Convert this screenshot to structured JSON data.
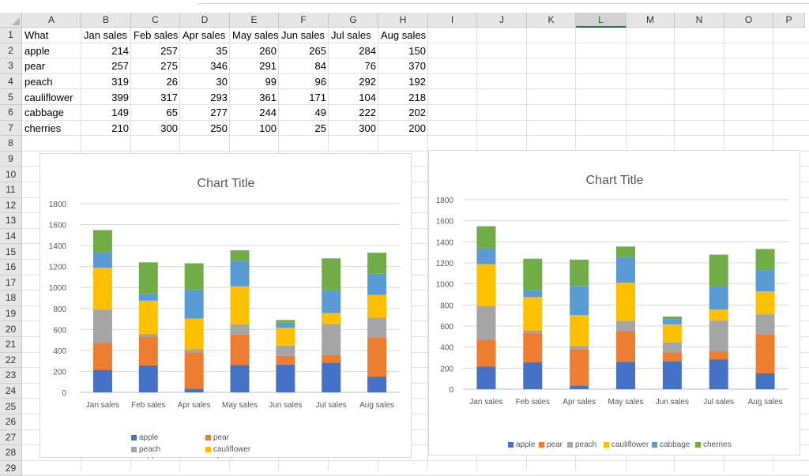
{
  "sheet": {
    "columns": [
      "A",
      "B",
      "C",
      "D",
      "E",
      "F",
      "G",
      "H",
      "I",
      "J",
      "K",
      "L",
      "M",
      "N",
      "O",
      "P"
    ],
    "selected_column": "L",
    "rows": [
      "1",
      "2",
      "3",
      "4",
      "5",
      "6",
      "7",
      "8",
      "9",
      "10",
      "11",
      "12",
      "13",
      "14",
      "15",
      "16",
      "17",
      "18",
      "19",
      "20",
      "21",
      "22",
      "23",
      "24",
      "25",
      "26",
      "27",
      "28",
      "29"
    ],
    "table": {
      "header": [
        "What",
        "Jan sales",
        "Feb sales",
        "Apr sales",
        "May sales",
        "Jun sales",
        "Jul sales",
        "Aug sales"
      ],
      "data": [
        [
          "apple",
          "214",
          "257",
          "35",
          "260",
          "265",
          "284",
          "150"
        ],
        [
          "pear",
          "257",
          "275",
          "346",
          "291",
          "84",
          "76",
          "370"
        ],
        [
          "peach",
          "319",
          "26",
          "30",
          "99",
          "96",
          "292",
          "192"
        ],
        [
          "cauliflower",
          "399",
          "317",
          "293",
          "361",
          "171",
          "104",
          "218"
        ],
        [
          "cabbage",
          "149",
          "65",
          "277",
          "244",
          "49",
          "222",
          "202"
        ],
        [
          "cherries",
          "210",
          "300",
          "250",
          "100",
          "25",
          "300",
          "200"
        ]
      ]
    }
  },
  "chart_data": [
    {
      "type": "bar",
      "stacked": true,
      "title": "Chart Title",
      "categories": [
        "Jan sales",
        "Feb sales",
        "Apr sales",
        "May sales",
        "Jun sales",
        "Jul sales",
        "Aug sales"
      ],
      "series": [
        {
          "name": "apple",
          "color": "#4472C4",
          "values": [
            214,
            257,
            35,
            260,
            265,
            284,
            150
          ]
        },
        {
          "name": "pear",
          "color": "#ED7D31",
          "values": [
            257,
            275,
            346,
            291,
            84,
            76,
            370
          ]
        },
        {
          "name": "peach",
          "color": "#A5A5A5",
          "values": [
            319,
            26,
            30,
            99,
            96,
            292,
            192
          ]
        },
        {
          "name": "cauliflower",
          "color": "#FFC000",
          "values": [
            399,
            317,
            293,
            361,
            171,
            104,
            218
          ]
        },
        {
          "name": "cabbage",
          "color": "#5B9BD5",
          "values": [
            149,
            65,
            277,
            244,
            49,
            222,
            202
          ]
        },
        {
          "name": "cherries",
          "color": "#70AD47",
          "values": [
            210,
            300,
            250,
            100,
            25,
            300,
            200
          ]
        }
      ],
      "y_ticks": [
        "0",
        "200",
        "400",
        "600",
        "800",
        "1000",
        "1200",
        "1400",
        "1600",
        "1800"
      ],
      "ylim": [
        0,
        1800
      ],
      "grid": true,
      "legend_position": "bottom-two-columns"
    },
    {
      "type": "bar",
      "stacked": true,
      "title": "Chart Title",
      "categories": [
        "Jan sales",
        "Feb sales",
        "Apr sales",
        "May sales",
        "Jun sales",
        "Jul sales",
        "Aug sales"
      ],
      "series": [
        {
          "name": "apple",
          "color": "#4472C4",
          "values": [
            214,
            257,
            35,
            260,
            265,
            284,
            150
          ]
        },
        {
          "name": "pear",
          "color": "#ED7D31",
          "values": [
            257,
            275,
            346,
            291,
            84,
            76,
            370
          ]
        },
        {
          "name": "peach",
          "color": "#A5A5A5",
          "values": [
            319,
            26,
            30,
            99,
            96,
            292,
            192
          ]
        },
        {
          "name": "cauliflower",
          "color": "#FFC000",
          "values": [
            399,
            317,
            293,
            361,
            171,
            104,
            218
          ]
        },
        {
          "name": "cabbage",
          "color": "#5B9BD5",
          "values": [
            149,
            65,
            277,
            244,
            49,
            222,
            202
          ]
        },
        {
          "name": "cherries",
          "color": "#70AD47",
          "values": [
            210,
            300,
            250,
            100,
            25,
            300,
            200
          ]
        }
      ],
      "y_ticks": [
        "0",
        "200",
        "400",
        "600",
        "800",
        "1000",
        "1200",
        "1400",
        "1600",
        "1800"
      ],
      "ylim": [
        0,
        1800
      ],
      "grid": true,
      "legend_position": "bottom-single-row"
    }
  ]
}
